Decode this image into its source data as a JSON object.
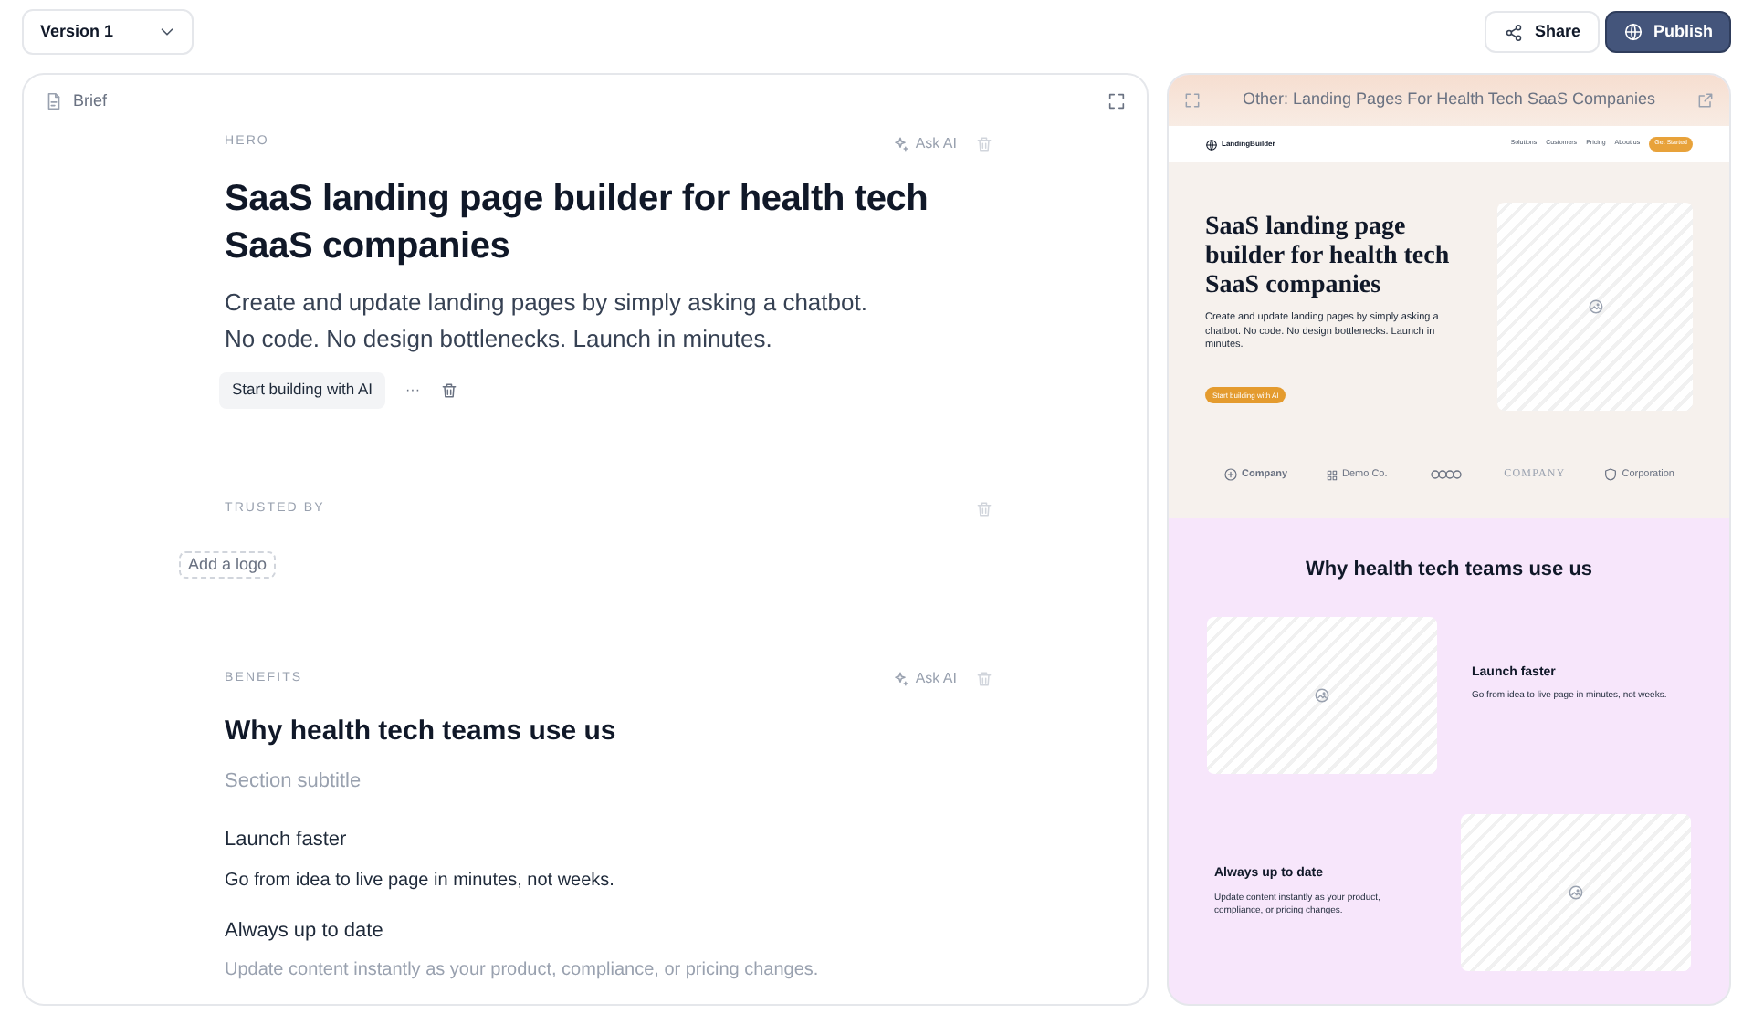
{
  "toolbar": {
    "version_select": "Version 1",
    "share": "Share",
    "publish": "Publish"
  },
  "editor": {
    "title": "Brief",
    "sections": [
      {
        "kind": "hero",
        "label": "HERO",
        "ask_ai": "Ask AI",
        "heading": "SaaS landing page builder for health tech SaaS companies",
        "text": "Create and update landing pages by simply asking a chatbot. No code. No design bottlenecks. Launch in minutes.",
        "cta": "Start building with AI",
        "more": "···"
      },
      {
        "kind": "logos",
        "label": "TRUSTED BY",
        "add": "Add a logo"
      },
      {
        "kind": "benefits",
        "label": "BENEFITS",
        "ask_ai": "Ask AI",
        "heading": "Why health tech teams use us",
        "subtitle_placeholder": "Section subtitle",
        "items": [
          {
            "title": "Launch faster",
            "text": "Go from idea to live page in minutes, not weeks.",
            "faded": false
          },
          {
            "title": "Always up to date",
            "text": "Update content instantly as your product, compliance, or pricing changes.",
            "faded": true
          }
        ]
      }
    ]
  },
  "preview": {
    "title": "Other: Landing Pages For Health Tech SaaS Companies",
    "nav": {
      "brand": "LandingBuilder",
      "links": [
        "Solutions",
        "Customers",
        "Pricing",
        "About us"
      ],
      "cta": "Get Started"
    },
    "hero": {
      "heading": "SaaS landing page builder for health tech SaaS companies",
      "text": "Create and update landing pages by simply asking a chatbot. No code. No design bottlenecks. Launch in minutes.",
      "cta": "Start building with AI"
    },
    "logos": [
      {
        "kind": "circle",
        "name": "Company"
      },
      {
        "kind": "grid",
        "name": "Demo Co."
      },
      {
        "kind": "rings"
      },
      {
        "kind": "serif",
        "name": "COMPANY"
      },
      {
        "kind": "shield",
        "name": "Corporation"
      }
    ],
    "benefits": {
      "heading": "Why health tech teams use us",
      "items": [
        {
          "title": "Launch faster",
          "text": "Go from idea to live page in minutes, not weeks.",
          "kind": "image-left"
        },
        {
          "title": "Always up to date",
          "text": "Update content instantly as your product, compliance, or pricing changes.",
          "kind": "image-right"
        }
      ]
    }
  }
}
